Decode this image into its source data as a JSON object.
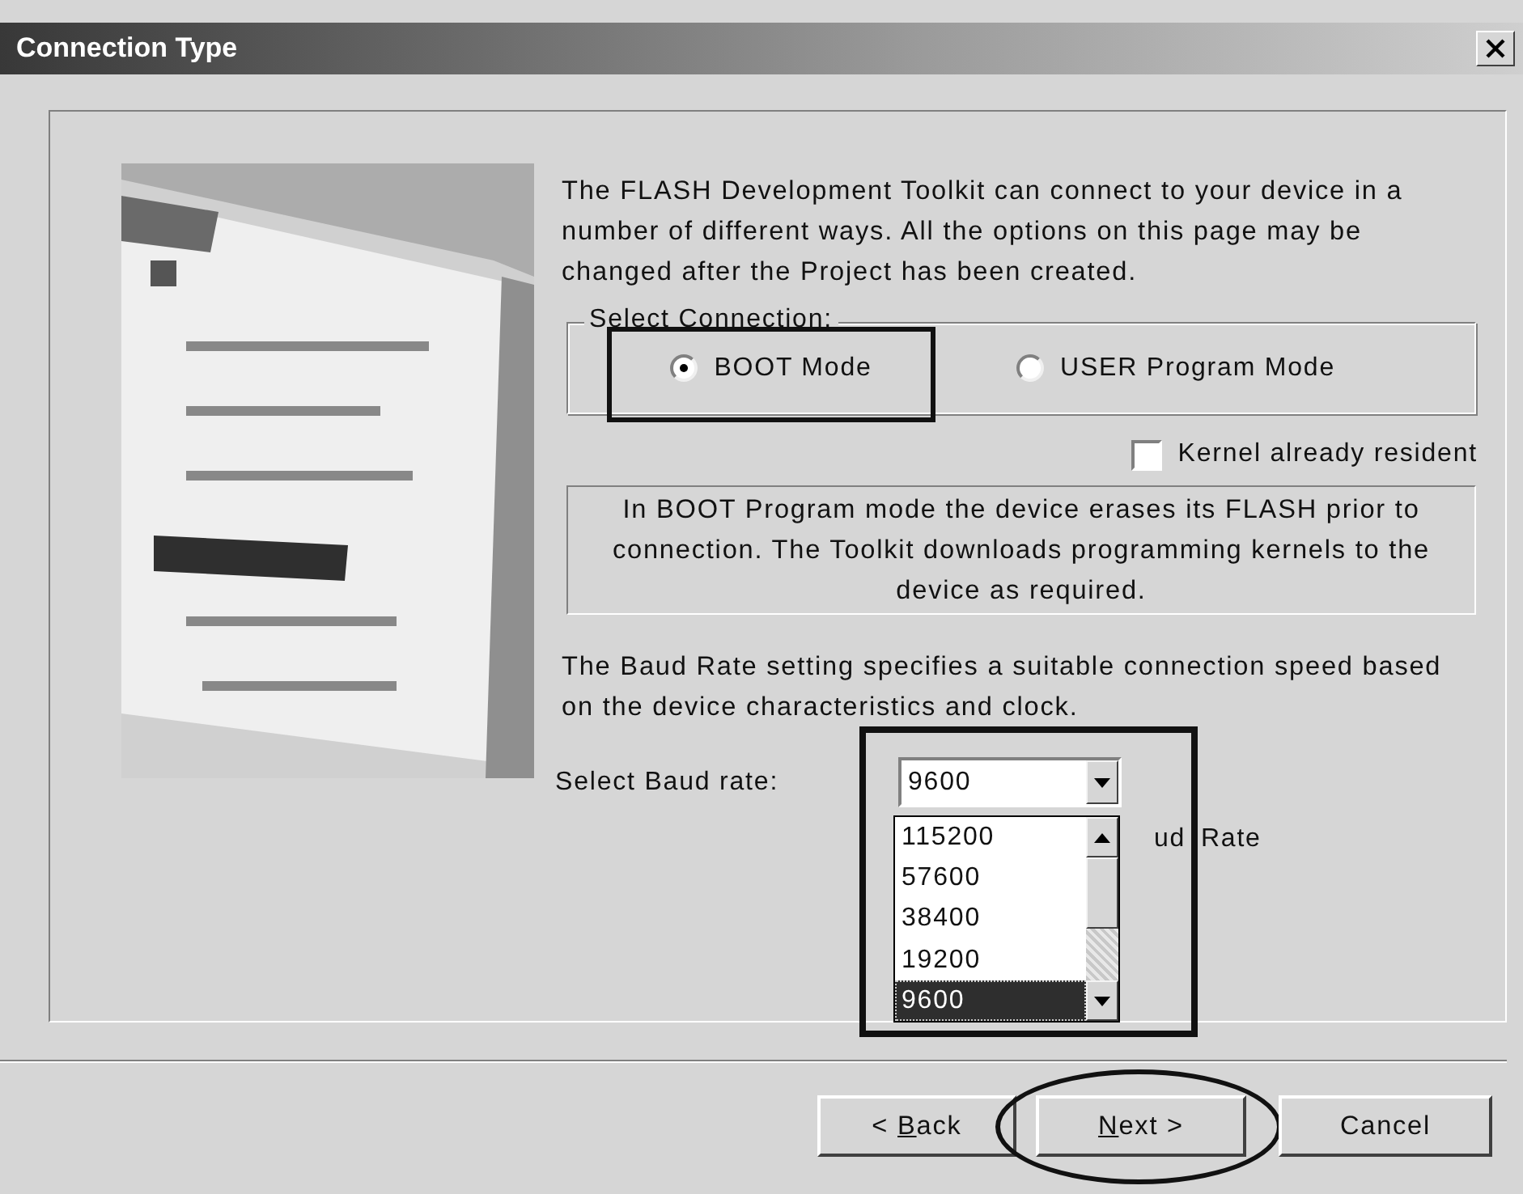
{
  "window": {
    "title": "Connection Type"
  },
  "intro": "The FLASH Development Toolkit can connect to your device in a number of different ways. All the options on this page may be changed after the Project has been created.",
  "connection": {
    "legend": "Select Connection:",
    "options": [
      {
        "label": "BOOT Mode",
        "selected": true,
        "highlighted": true
      },
      {
        "label": "USER Program Mode",
        "selected": false,
        "highlighted": false
      }
    ]
  },
  "kernel_checkbox": {
    "label": "Kernel already resident",
    "checked": false
  },
  "mode_info": "In BOOT Program mode the device erases its FLASH prior to connection. The Toolkit downloads programming kernels to the device as required.",
  "baud_info": "The Baud Rate setting specifies a suitable connection speed based on the device characteristics and clock.",
  "baud": {
    "label": "Select Baud rate:",
    "value": "9600",
    "expanded": true,
    "highlighted": true,
    "options": [
      {
        "label": "115200",
        "selected": false
      },
      {
        "label": "57600",
        "selected": false
      },
      {
        "label": "38400",
        "selected": false
      },
      {
        "label": "19200",
        "selected": false
      },
      {
        "label": "9600",
        "selected": true
      }
    ]
  },
  "partly_hidden_label": "ud Rate",
  "buttons": [
    {
      "before": "< ",
      "mnemonic": "B",
      "after": "ack",
      "circled": false
    },
    {
      "mnemonic": "N",
      "after": "ext >",
      "circled": true
    },
    {
      "label": "Cancel",
      "circled": false
    }
  ]
}
